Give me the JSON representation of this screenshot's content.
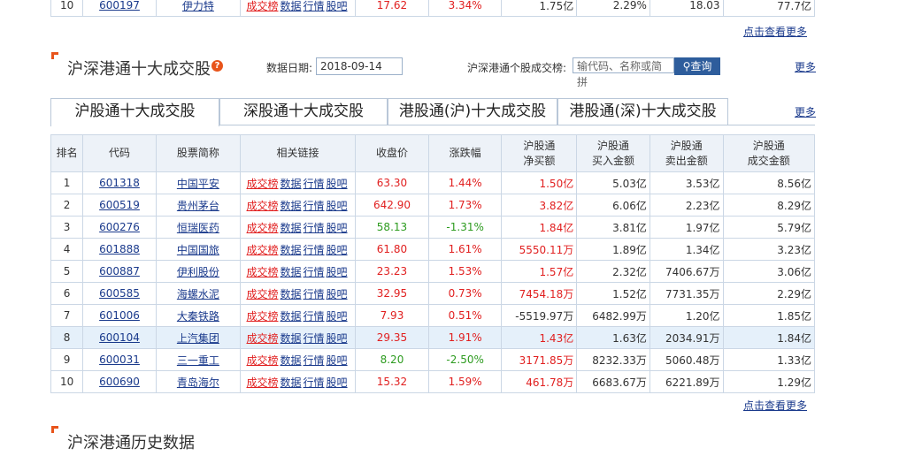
{
  "top_row": {
    "rank": "10",
    "code": "600197",
    "name": "伊力特",
    "links": [
      "成交榜",
      "数据",
      "行情",
      "股吧"
    ],
    "close": "17.62",
    "change": "3.34%",
    "net_buy": "1.75亿",
    "c6": "2.29%",
    "c7": "18.03",
    "c8": "77.7亿"
  },
  "more_top": "点击查看更多",
  "section1": {
    "title": "沪深港通十大成交股",
    "help": "?",
    "date_label": "数据日期:",
    "date_value": "2018-09-14",
    "search_label": "沪深港通个股成交榜:",
    "search_placeholder": "输代码、名称或简拼",
    "search_button": "查询",
    "more": "更多"
  },
  "tabs": [
    "沪股通十大成交股",
    "深股通十大成交股",
    "港股通(沪)十大成交股",
    "港股通(深)十大成交股"
  ],
  "tabs_more": "更多",
  "table": {
    "headers": [
      "排名",
      "代码",
      "股票简称",
      "相关链接",
      "收盘价",
      "涨跌幅",
      "沪股通\n净买额",
      "沪股通\n买入金额",
      "沪股通\n卖出金额",
      "沪股通\n成交金额"
    ],
    "link_labels": [
      "成交榜",
      "数据",
      "行情",
      "股吧"
    ],
    "rows": [
      {
        "rank": "1",
        "code": "601318",
        "name": "中国平安",
        "close": "63.30",
        "change": "1.44%",
        "net": "1.50亿",
        "buy": "5.03亿",
        "sell": "3.53亿",
        "total": "8.56亿",
        "dir": "up",
        "net_dir": "up"
      },
      {
        "rank": "2",
        "code": "600519",
        "name": "贵州茅台",
        "close": "642.90",
        "change": "1.73%",
        "net": "3.82亿",
        "buy": "6.06亿",
        "sell": "2.23亿",
        "total": "8.29亿",
        "dir": "up",
        "net_dir": "up"
      },
      {
        "rank": "3",
        "code": "600276",
        "name": "恒瑞医药",
        "close": "58.13",
        "change": "-1.31%",
        "net": "1.84亿",
        "buy": "3.81亿",
        "sell": "1.97亿",
        "total": "5.79亿",
        "dir": "down",
        "net_dir": "up"
      },
      {
        "rank": "4",
        "code": "601888",
        "name": "中国国旅",
        "close": "61.80",
        "change": "1.61%",
        "net": "5550.11万",
        "buy": "1.89亿",
        "sell": "1.34亿",
        "total": "3.23亿",
        "dir": "up",
        "net_dir": "up"
      },
      {
        "rank": "5",
        "code": "600887",
        "name": "伊利股份",
        "close": "23.23",
        "change": "1.53%",
        "net": "1.57亿",
        "buy": "2.32亿",
        "sell": "7406.67万",
        "total": "3.06亿",
        "dir": "up",
        "net_dir": "up"
      },
      {
        "rank": "6",
        "code": "600585",
        "name": "海螺水泥",
        "close": "32.95",
        "change": "0.73%",
        "net": "7454.18万",
        "buy": "1.52亿",
        "sell": "7731.35万",
        "total": "2.29亿",
        "dir": "up",
        "net_dir": "up"
      },
      {
        "rank": "7",
        "code": "601006",
        "name": "大秦铁路",
        "close": "7.93",
        "change": "0.51%",
        "net": "-5519.97万",
        "buy": "6482.99万",
        "sell": "1.20亿",
        "total": "1.85亿",
        "dir": "up",
        "net_dir": "down"
      },
      {
        "rank": "8",
        "code": "600104",
        "name": "上汽集团",
        "close": "29.35",
        "change": "1.91%",
        "net": "1.43亿",
        "buy": "1.63亿",
        "sell": "2034.91万",
        "total": "1.84亿",
        "dir": "up",
        "net_dir": "up"
      },
      {
        "rank": "9",
        "code": "600031",
        "name": "三一重工",
        "close": "8.20",
        "change": "-2.50%",
        "net": "3171.85万",
        "buy": "8232.33万",
        "sell": "5060.48万",
        "total": "1.33亿",
        "dir": "down",
        "net_dir": "up"
      },
      {
        "rank": "10",
        "code": "600690",
        "name": "青岛海尔",
        "close": "15.32",
        "change": "1.59%",
        "net": "461.78万",
        "buy": "6683.67万",
        "sell": "6221.89万",
        "total": "1.29亿",
        "dir": "up",
        "net_dir": "up"
      }
    ]
  },
  "more_bottom": "点击查看更多",
  "section2": {
    "title": "沪深港通历史数据"
  },
  "colors": {
    "accent": "#e8541b",
    "up": "#e12020",
    "down": "#2d9b1f",
    "link": "#1a3a8c",
    "header_bg": "#edf2f8",
    "highlight_row": "#e5f0fa",
    "button": "#2e5d9c"
  }
}
